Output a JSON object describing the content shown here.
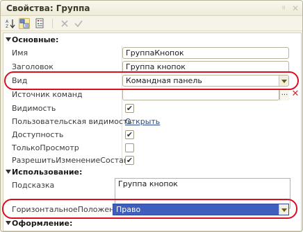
{
  "window": {
    "title": "Свойства: Группа",
    "pin_icon": "pin-icon",
    "close_icon": "close-icon"
  },
  "toolbar": {
    "icons": [
      "sort-alphabetical-icon",
      "categorized-view-icon",
      "property-list-icon",
      "clear-icon",
      "apply-check-icon"
    ]
  },
  "sections": {
    "main": "Основные:",
    "usage": "Использование:",
    "appearance": "Оформление:"
  },
  "properties": {
    "name": {
      "label": "Имя",
      "value": "ГруппаКнопок"
    },
    "title": {
      "label": "Заголовок",
      "value": "Группа кнопок"
    },
    "kind": {
      "label": "Вид",
      "value": "Командная панель"
    },
    "command_source": {
      "label": "Источник команд",
      "value": "",
      "button": "..."
    },
    "visibility": {
      "label": "Видимость",
      "checked": true
    },
    "user_visibility": {
      "label": "Пользовательская видимость",
      "link": "Открыть"
    },
    "availability": {
      "label": "Доступность",
      "checked": true
    },
    "read_only": {
      "label": "ТолькоПросмотр",
      "checked": false
    },
    "allow_change_content": {
      "label": "РазрешитьИзменениеСостава",
      "checked": true
    },
    "tooltip": {
      "label": "Подсказка",
      "value": "Группа кнопок"
    },
    "horizontal_position": {
      "label": "ГоризонтальноеПоложение",
      "value": "Право"
    }
  },
  "check_mark": "✔",
  "colors": {
    "highlight_oval": "#d61020",
    "selection": "#3e5fbd"
  }
}
